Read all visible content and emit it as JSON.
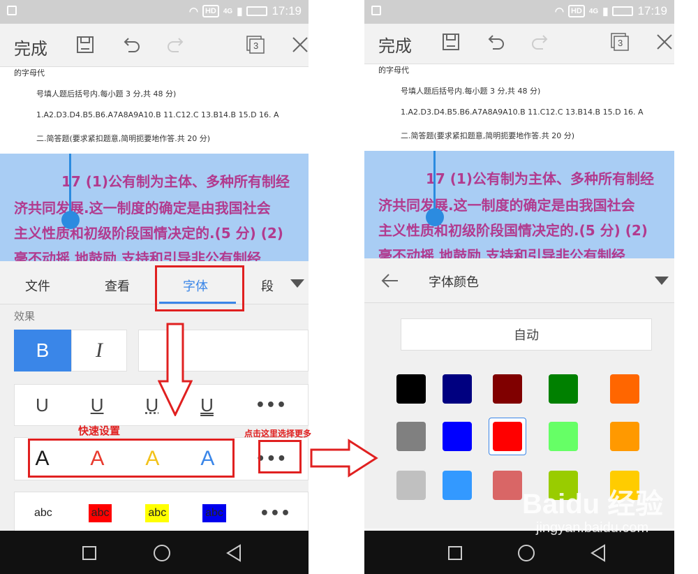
{
  "status_bar": {
    "network": "4G",
    "hd": "HD",
    "time": "17:19"
  },
  "toolbar": {
    "done_label": "完成",
    "page_count": "3"
  },
  "document": {
    "lines": [
      "的字母代",
      "号填人题后括号内.每小题 3 分,共 48 分)",
      "1.A2.D3.D4.B5.B6.A7A8A9A10.B 11.C12.C 13.B14.B 15.D 16. A",
      "二.简答题(要求紧扣题意,简明扼要地作答.共 20 分)"
    ],
    "highlighted_lines": [
      "17 (1)公有制为主体、多种所有制经",
      "济共同发展.这一制度的确定是由我国社会",
      "主义性质和初级阶段国情决定的.(5 分) (2)",
      "毫不动摇 地鼓励 支持和引导非公有制经"
    ]
  },
  "left_tabs": {
    "items": [
      "文件",
      "查看",
      "字体",
      "段"
    ],
    "active": "字体"
  },
  "font_panel": {
    "effects_label": "效果",
    "bold_label": "B",
    "italic_label": "I",
    "underline_labels": [
      "U",
      "U",
      "U",
      "U"
    ],
    "more_label": "•••",
    "color_letters": [
      {
        "label": "A",
        "color": "#1a1a1a"
      },
      {
        "label": "A",
        "color": "#e83a2e"
      },
      {
        "label": "A",
        "color": "#f2c21a"
      },
      {
        "label": "A",
        "color": "#3a86e8"
      }
    ],
    "highlight_samples": [
      {
        "label": "abc",
        "bg": "transparent"
      },
      {
        "label": "abc",
        "bg": "#ff0000"
      },
      {
        "label": "abc",
        "bg": "#ffff00"
      },
      {
        "label": "abc",
        "bg": "#0000ee"
      }
    ]
  },
  "annotations": {
    "quick_settings": "快速设置",
    "click_more": "点击这里选择更多"
  },
  "right_panel": {
    "back_icon": "arrow-left-icon",
    "title": "字体颜色",
    "auto_label": "自动",
    "selected_color": "#ff0000",
    "swatch_rows": [
      [
        "#000000",
        "#000080",
        "#800000",
        "#008000",
        "#ff6600"
      ],
      [
        "#808080",
        "#0000ff",
        "#ff0000",
        "#66ff66",
        "#ff9900"
      ],
      [
        "#c0c0c0",
        "#3399ff",
        "#d96666",
        "#99cc00",
        "#ffcc00"
      ]
    ]
  },
  "watermark": {
    "brand": "Baidu 经验",
    "url": "jingyan.baidu.com"
  }
}
